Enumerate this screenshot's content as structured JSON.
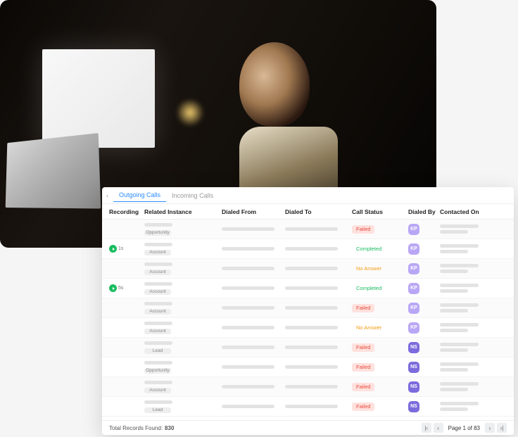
{
  "tabs": {
    "outgoing": "Outgoing Calls",
    "incoming": "Incoming Calls"
  },
  "columns": {
    "recording": "Recording",
    "related": "Related Instance",
    "from": "Dialed From",
    "to": "Dialed To",
    "status": "Call Status",
    "by": "Dialed By",
    "on": "Contacted On"
  },
  "status_styles": {
    "Failed": {
      "bg": "#ffe1de",
      "fg": "#e74c3c"
    },
    "Completed": {
      "bg": "transparent",
      "fg": "#1abc60"
    },
    "No Answer": {
      "bg": "transparent",
      "fg": "#f39c12"
    }
  },
  "avatar_styles": {
    "KP": {
      "bg": "#b9a7f5",
      "fg": "#ffffff"
    },
    "NS": {
      "bg": "#7c6bdc",
      "fg": "#ffffff"
    }
  },
  "rows": [
    {
      "recording": null,
      "related_tag": "Opportunity",
      "status": "Failed",
      "by": "KP"
    },
    {
      "recording": "1s",
      "related_tag": "Account",
      "status": "Completed",
      "by": "KP"
    },
    {
      "recording": null,
      "related_tag": "Account",
      "status": "No Answer",
      "by": "KP"
    },
    {
      "recording": "5s",
      "related_tag": "Account",
      "status": "Completed",
      "by": "KP"
    },
    {
      "recording": null,
      "related_tag": "Account",
      "status": "Failed",
      "by": "KP"
    },
    {
      "recording": null,
      "related_tag": "Account",
      "status": "No Answer",
      "by": "KP"
    },
    {
      "recording": null,
      "related_tag": "Lead",
      "status": "Failed",
      "by": "NS"
    },
    {
      "recording": null,
      "related_tag": "Opportunity",
      "status": "Failed",
      "by": "NS"
    },
    {
      "recording": null,
      "related_tag": "Account",
      "status": "Failed",
      "by": "NS"
    },
    {
      "recording": null,
      "related_tag": "Lead",
      "status": "Failed",
      "by": "NS"
    }
  ],
  "footer": {
    "label": "Total Records Found:",
    "count": "830",
    "page_text": "Page 1 of 83"
  }
}
